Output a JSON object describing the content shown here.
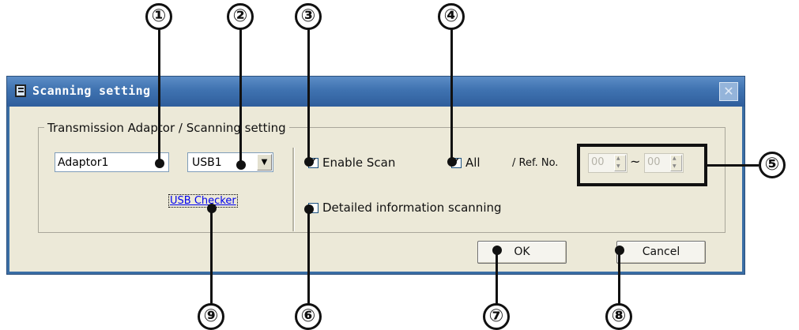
{
  "window": {
    "title": "Scanning setting",
    "close_symbol": "✕"
  },
  "group": {
    "title": "Transmission Adaptor / Scanning setting"
  },
  "adaptor": {
    "name_value": "Adaptor1",
    "port_value": "USB1",
    "dropdown_arrow": "▼",
    "usb_checker_link": "USB Checker"
  },
  "scan": {
    "enable_scan_label": "Enable Scan",
    "enable_scan_checked": true,
    "all_label": "All",
    "all_checked": true,
    "ref_no_label": "/ Ref. No.",
    "ref_from_value": "00",
    "ref_to_value": "00",
    "tilde": "~",
    "detailed_label": "Detailed information scanning",
    "detailed_checked": false
  },
  "buttons": {
    "ok_label": "OK",
    "cancel_label": "Cancel"
  },
  "callouts": [
    "①",
    "②",
    "③",
    "④",
    "⑤",
    "⑥",
    "⑦",
    "⑧",
    "⑨"
  ],
  "colors": {
    "title_bar": "#3f72b0",
    "client_background": "#ece9d8",
    "link": "#0000ee"
  }
}
